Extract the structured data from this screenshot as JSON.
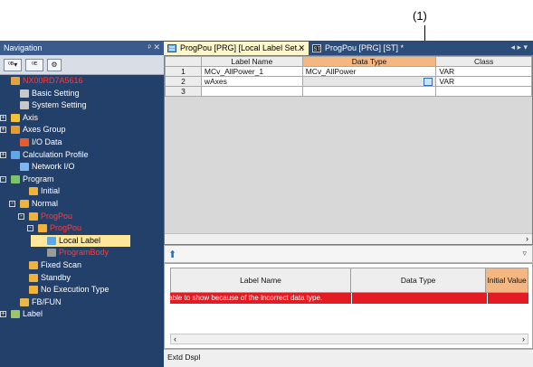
{
  "callout": {
    "label": "(1)"
  },
  "nav": {
    "title": "Navigation",
    "controls": "ᵖ ✕",
    "toolbar": [
      "⁰ᴮ▾",
      "⁰ᴱ",
      "⚙"
    ],
    "tree": [
      {
        "label": "NX00RD7A5616",
        "depth": 0,
        "red": true,
        "icon": "project-icon"
      },
      {
        "label": "Basic Setting",
        "depth": 1,
        "icon": "settings-icon"
      },
      {
        "label": "System Setting",
        "depth": 1,
        "icon": "settings-icon"
      },
      {
        "label": "Axis",
        "depth": 0,
        "exp": "+",
        "icon": "axis-icon"
      },
      {
        "label": "Axes Group",
        "depth": 0,
        "exp": "+",
        "icon": "axes-group-icon"
      },
      {
        "label": "I/O Data",
        "depth": 1,
        "icon": "io-icon"
      },
      {
        "label": "Calculation Profile",
        "depth": 0,
        "exp": "+",
        "icon": "calc-icon"
      },
      {
        "label": "Network I/O",
        "depth": 1,
        "icon": "network-icon"
      },
      {
        "label": "Program",
        "depth": 0,
        "exp": "-",
        "icon": "program-icon"
      },
      {
        "label": "Initial",
        "depth": 2,
        "icon": "task-icon"
      },
      {
        "label": "Normal",
        "depth": 1,
        "exp": "-",
        "icon": "task-icon"
      },
      {
        "label": "ProgPou",
        "depth": 2,
        "exp": "-",
        "red": true,
        "icon": "pou-icon"
      },
      {
        "label": "ProgPou",
        "depth": 3,
        "exp": "-",
        "red": true,
        "icon": "pou-icon"
      },
      {
        "label": "Local Label",
        "depth": 4,
        "selected": true,
        "icon": "label-icon"
      },
      {
        "label": "ProgramBody",
        "depth": 4,
        "red": true,
        "icon": "body-icon"
      },
      {
        "label": "Fixed Scan",
        "depth": 2,
        "icon": "task-icon"
      },
      {
        "label": "Standby",
        "depth": 2,
        "icon": "task-icon"
      },
      {
        "label": "No Execution Type",
        "depth": 2,
        "icon": "task-icon"
      },
      {
        "label": "FB/FUN",
        "depth": 1,
        "icon": "fbfun-icon"
      },
      {
        "label": "Label",
        "depth": 0,
        "exp": "+",
        "icon": "label-folder-icon"
      }
    ]
  },
  "tabs": [
    {
      "label": "ProgPou [PRG] [Local Label Set...",
      "close": "✕",
      "active": true
    },
    {
      "label": "ProgPou [PRG] [ST] *",
      "active": false
    }
  ],
  "tab_scroll": "◂ ▸ ▾",
  "grid": {
    "headers": [
      "Label Name",
      "Data Type",
      "Class"
    ],
    "rows": [
      {
        "num": "1",
        "name": "MCv_AllPower_1",
        "type": "MCv_AllPower",
        "cls": "VAR"
      },
      {
        "num": "2",
        "name": "wAxes",
        "type": "",
        "cls": "VAR"
      },
      {
        "num": "3",
        "name": "",
        "type": "",
        "cls": ""
      }
    ],
    "scroll_right": "›"
  },
  "split": {
    "up": "⬆",
    "down": "▿"
  },
  "lower": {
    "headers": [
      "Label Name",
      "Data Type",
      "Initial Value"
    ],
    "error": "Unable to show because of the incorrect data type.",
    "scroll_left": "‹",
    "scroll_right": "›"
  },
  "status": {
    "tab": "Extd Dspl"
  }
}
